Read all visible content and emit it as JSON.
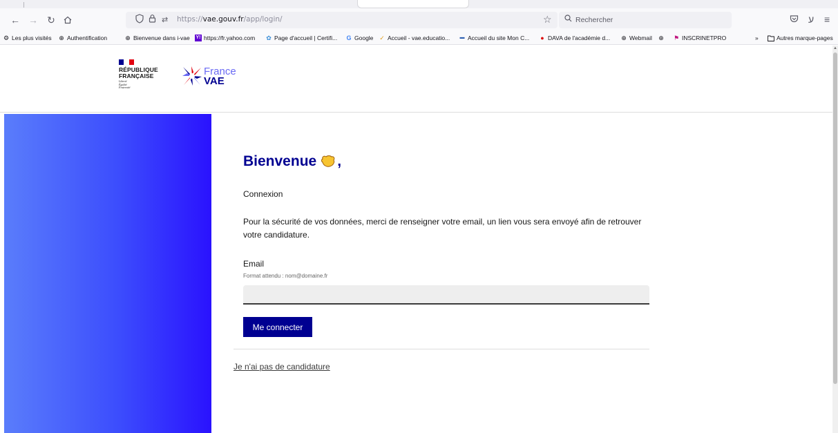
{
  "browser": {
    "address": {
      "prefix": "https://",
      "domain": "vae.gouv.fr",
      "path": "/app/login/"
    },
    "search_placeholder": "Rechercher",
    "bookmarks": [
      {
        "label": "Les plus visités",
        "icon": "gear-icon"
      },
      {
        "label": "Authentification",
        "icon": "globe-icon"
      },
      {
        "label": "Bienvenue dans i-vae",
        "icon": "globe-icon"
      },
      {
        "label": "https://fr.yahoo.com",
        "icon": "yahoo-icon"
      },
      {
        "label": "Page d'accueil | Certifi...",
        "icon": "puzzle-icon"
      },
      {
        "label": "Google",
        "icon": "google-icon"
      },
      {
        "label": "Accueil - vae.educatio...",
        "icon": "check-icon"
      },
      {
        "label": "Accueil du site Mon C...",
        "icon": "site-icon"
      },
      {
        "label": "DAVA de l'académie d...",
        "icon": "dava-icon"
      },
      {
        "label": "Webmail",
        "icon": "globe-icon"
      },
      {
        "label": "",
        "icon": "globe-icon"
      },
      {
        "label": "INSCRINETPRO",
        "icon": "pin-icon"
      }
    ],
    "overflow": "»",
    "other_bookmarks": "Autres marque-pages"
  },
  "header": {
    "republique_line1": "RÉPUBLIQUE",
    "republique_line2": "FRANÇAISE",
    "motto_1": "Liberté",
    "motto_2": "Égalité",
    "motto_3": "Fraternité",
    "logo_word1": "France",
    "logo_word2": "VAE"
  },
  "login": {
    "title": "Bienvenue",
    "title_suffix": ",",
    "subtitle": "Connexion",
    "intro": "Pour la sécurité de vos données, merci de renseigner votre email, un lien vous sera envoyé afin de retrouver votre candidature.",
    "email_label": "Email",
    "email_hint": "Format attendu : nom@domaine.fr",
    "email_value": "",
    "submit_label": "Me connecter",
    "no_candidature_link": "Je n'ai pas de candidature"
  },
  "colors": {
    "primary": "#000091",
    "gradient_start": "#5a7dfb",
    "gradient_end": "#2a12fe",
    "flag_blue": "#000091",
    "flag_red": "#e1000f"
  }
}
